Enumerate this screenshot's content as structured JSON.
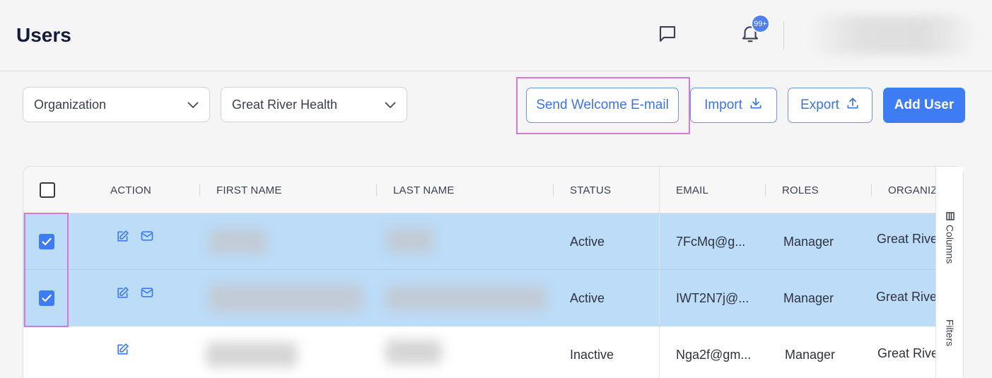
{
  "header": {
    "title": "Users",
    "notification_count": "99+"
  },
  "filters": {
    "filter_by": "Organization",
    "organization": "Great River Health"
  },
  "actions": {
    "send_welcome": "Send Welcome E-mail",
    "import": "Import",
    "export": "Export",
    "add_user": "Add User"
  },
  "table": {
    "columns": [
      "ACTION",
      "FIRST NAME",
      "LAST NAME",
      "STATUS",
      "EMAIL",
      "ROLES",
      "ORGANIZ"
    ],
    "rows": [
      {
        "selected": true,
        "status": "Active",
        "email": "7FcMq@g...",
        "role": "Manager",
        "organization": "Great River"
      },
      {
        "selected": true,
        "status": "Active",
        "email": "IWT2N7j@...",
        "role": "Manager",
        "organization": "Great River"
      },
      {
        "selected": false,
        "status": "Inactive",
        "email": "Nga2f@gm...",
        "role": "Manager",
        "organization": "Great River"
      }
    ]
  },
  "side_panel": {
    "columns": "Columns",
    "filters": "Filters"
  },
  "colors": {
    "accent": "#3e7cf3",
    "selected_row": "#bcdcf8",
    "highlight": "#d47ad8"
  }
}
